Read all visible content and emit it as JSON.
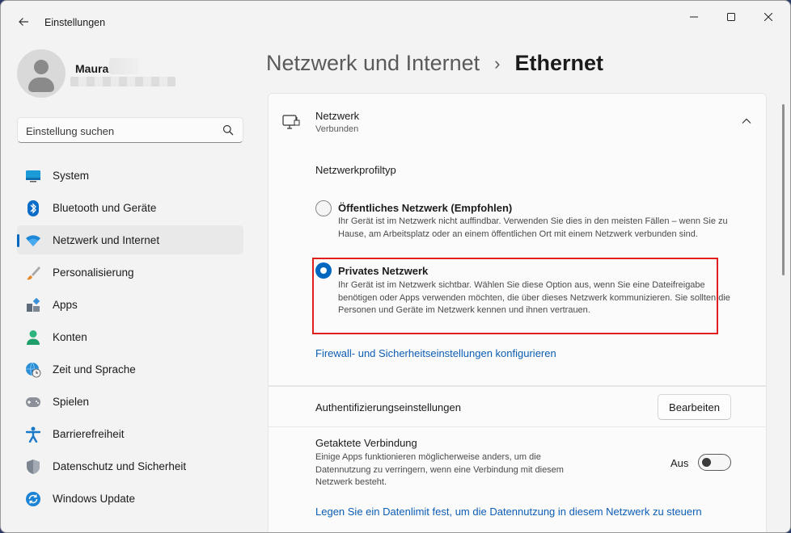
{
  "window": {
    "title": "Einstellungen",
    "controls": {
      "minimize": "minimize-icon",
      "maximize": "maximize-icon",
      "close": "close-icon"
    }
  },
  "profile": {
    "name": "Maura"
  },
  "search": {
    "placeholder": "Einstellung suchen"
  },
  "sidebar": {
    "items": [
      {
        "label": "System",
        "icon": "system-icon"
      },
      {
        "label": "Bluetooth und Geräte",
        "icon": "bluetooth-icon"
      },
      {
        "label": "Netzwerk und Internet",
        "icon": "wifi-icon",
        "active": true
      },
      {
        "label": "Personalisierung",
        "icon": "brush-icon"
      },
      {
        "label": "Apps",
        "icon": "apps-icon"
      },
      {
        "label": "Konten",
        "icon": "account-icon"
      },
      {
        "label": "Zeit und Sprache",
        "icon": "globe-clock-icon"
      },
      {
        "label": "Spielen",
        "icon": "gamepad-icon"
      },
      {
        "label": "Barrierefreiheit",
        "icon": "accessibility-icon"
      },
      {
        "label": "Datenschutz und Sicherheit",
        "icon": "shield-icon"
      },
      {
        "label": "Windows Update",
        "icon": "update-icon"
      }
    ]
  },
  "breadcrumb": {
    "parent": "Netzwerk und Internet",
    "separator": "›",
    "current": "Ethernet"
  },
  "network_card": {
    "title": "Netzwerk",
    "status": "Verbunden",
    "profile_type_label": "Netzwerkprofiltyp",
    "options": [
      {
        "title": "Öffentliches Netzwerk (Empfohlen)",
        "description": "Ihr Gerät ist im Netzwerk nicht auffindbar. Verwenden Sie dies in den meisten Fällen – wenn Sie zu Hause, am Arbeitsplatz oder an einem öffentlichen Ort mit einem Netzwerk verbunden sind.",
        "selected": false
      },
      {
        "title": "Privates Netzwerk",
        "description": "Ihr Gerät ist im Netzwerk sichtbar. Wählen Sie diese Option aus, wenn Sie eine Dateifreigabe benötigen oder Apps verwenden möchten, die über dieses Netzwerk kommunizieren. Sie sollten die Personen und Geräte im Netzwerk kennen und ihnen vertrauen.",
        "selected": true
      }
    ],
    "firewall_link": "Firewall- und Sicherheitseinstellungen konfigurieren"
  },
  "auth": {
    "label": "Authentifizierungseinstellungen",
    "button": "Bearbeiten"
  },
  "metered": {
    "title": "Getaktete Verbindung",
    "description": "Einige Apps funktionieren möglicherweise anders, um die Datennutzung zu verringern, wenn eine Verbindung mit diesem Netzwerk besteht.",
    "toggle_label": "Aus",
    "toggle_on": false,
    "limit_link": "Legen Sie ein Datenlimit fest, um die Datennutzung in diesem Netzwerk zu steuern"
  },
  "colors": {
    "accent": "#0067c0",
    "link": "#0c5db5",
    "highlight": "#e21f1f"
  }
}
